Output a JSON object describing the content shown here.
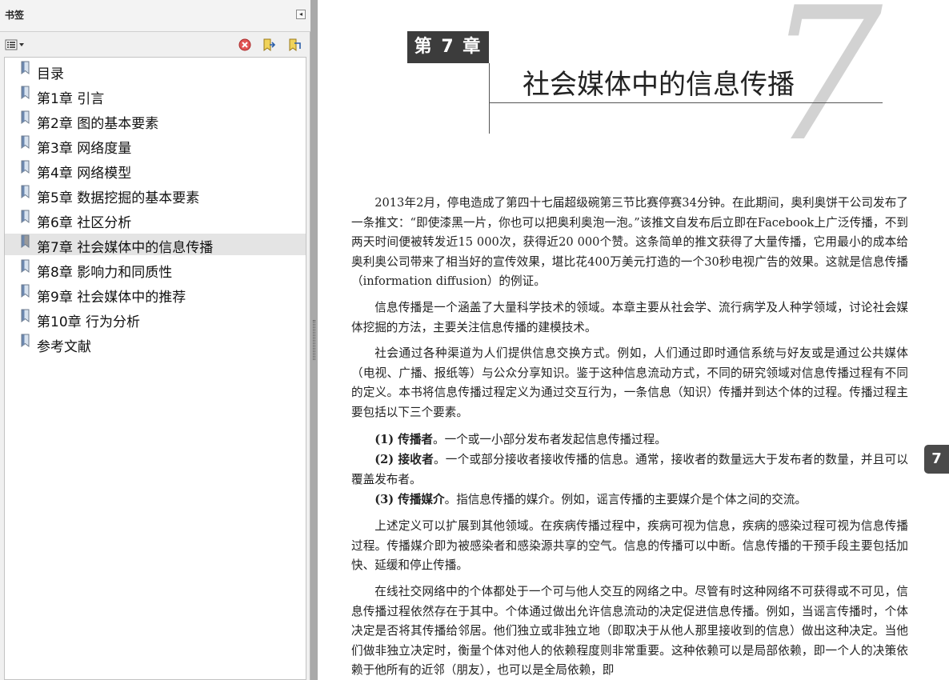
{
  "panel": {
    "title": "书签",
    "collapse_glyph": "◂",
    "icons": {
      "options": "options-menu-icon",
      "delete": "delete-bookmark-icon",
      "expand": "expand-bookmark-icon",
      "new": "new-bookmark-icon"
    }
  },
  "bookmarks": [
    {
      "label": "目录"
    },
    {
      "label": "第1章 引言"
    },
    {
      "label": "第2章 图的基本要素"
    },
    {
      "label": "第3章 网络度量"
    },
    {
      "label": "第4章 网络模型"
    },
    {
      "label": "第5章 数据挖掘的基本要素"
    },
    {
      "label": "第6章 社区分析"
    },
    {
      "label": "第7章 社会媒体中的信息传播",
      "selected": true
    },
    {
      "label": "第8章 影响力和同质性"
    },
    {
      "label": "第9章 社会媒体中的推荐"
    },
    {
      "label": "第10章 行为分析"
    },
    {
      "label": "参考文献"
    }
  ],
  "document": {
    "chapter_badge": "第 7 章",
    "chapter_number": "7",
    "chapter_title": "社会媒体中的信息传播",
    "thumb_tab": "7",
    "p1": "2013年2月，停电造成了第四十七届超级碗第三节比赛停赛34分钟。在此期间，奥利奥饼干公司发布了一条推文：“即使漆黑一片，你也可以把奥利奥泡一泡。”该推文自发布后立即在Facebook上广泛传播，不到两天时间便被转发近15 000次，获得近20 000个赞。这条简单的推文获得了大量传播，它用最小的成本给奥利奥公司带来了相当好的宣传效果，堪比花400万美元打造的一个30秒电视广告的效果。这就是信息传播（information diffusion）的例证。",
    "p2": "信息传播是一个涵盖了大量科学技术的领域。本章主要从社会学、流行病学及人种学领域，讨论社会媒体挖掘的方法，主要关注信息传播的建模技术。",
    "p3": "社会通过各种渠道为人们提供信息交换方式。例如，人们通过即时通信系统与好友或是通过公共媒体（电视、广播、报纸等）与公众分享知识。鉴于这种信息流动方式，不同的研究领域对信息传播过程有不同的定义。本书将信息传播过程定义为通过交互行为，一条信息（知识）传播并到达个体的过程。传播过程主要包括以下三个要素。",
    "item1_label": "(1) 传播者",
    "item1_text": "。一个或一小部分发布者发起信息传播过程。",
    "item2_label": "(2) 接收者",
    "item2_text": "。一个或部分接收者接收传播的信息。通常，接收者的数量远大于发布者的数量，并且可以覆盖发布者。",
    "item3_label": "(3) 传播媒介",
    "item3_text": "。指信息传播的媒介。例如，谣言传播的主要媒介是个体之间的交流。",
    "p4": "上述定义可以扩展到其他领域。在疾病传播过程中，疾病可视为信息，疾病的感染过程可视为信息传播过程。传播媒介即为被感染者和感染源共享的空气。信息的传播可以中断。信息传播的干预手段主要包括加快、延缓和停止传播。",
    "p5": "在线社交网络中的个体都处于一个可与他人交互的网络之中。尽管有时这种网络不可获得或不可见，信息传播过程依然存在于其中。个体通过做出允许信息流动的决定促进信息传播。例如，当谣言传播时，个体决定是否将其传播给邻居。他们独立或非独立地（即取决于从他人那里接收到的信息）做出这种决定。当他们做非独立决定时，衡量个体对他人的依赖程度则非常重要。这种依赖可以是局部依赖，即一个人的决策依赖于他所有的近邻（朋友），也可以是全局依赖，即"
  }
}
